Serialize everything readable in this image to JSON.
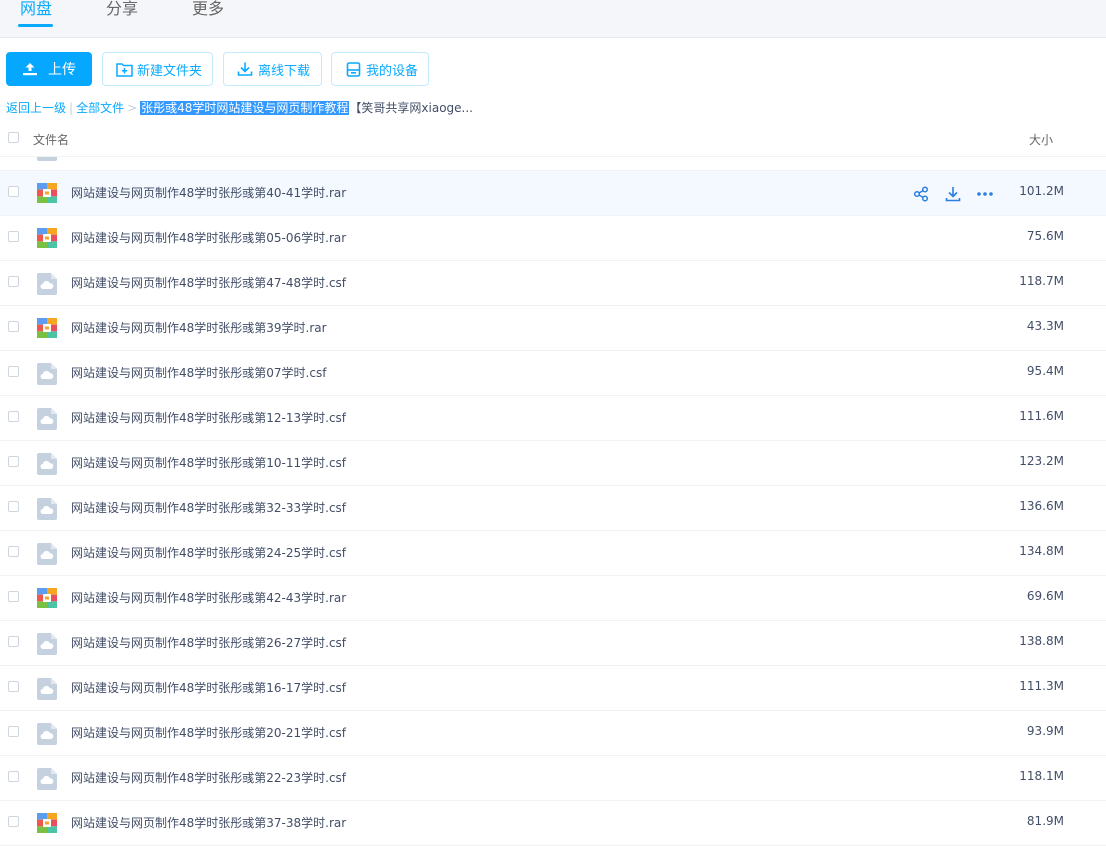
{
  "nav": {
    "tabs": [
      {
        "label": "网盘",
        "active": true
      },
      {
        "label": "分享",
        "active": false
      },
      {
        "label": "更多",
        "active": false
      }
    ]
  },
  "toolbar": {
    "upload": "上传",
    "new_folder": "新建文件夹",
    "offline_download": "离线下载",
    "my_devices": "我的设备"
  },
  "breadcrumb": {
    "back": "返回上一级",
    "root": "全部文件",
    "current": "张彤彧48学时网站建设与网页制作教程",
    "rest": "【笑哥共享网xiaoge..."
  },
  "table": {
    "col_name": "文件名",
    "col_size": "大小"
  },
  "files": [
    {
      "name": "网站建设与网页制作48学时张彤彧第40-41学时.rar",
      "size": "101.2M",
      "type": "rar",
      "hovered": true
    },
    {
      "name": "网站建设与网页制作48学时张彤彧第05-06学时.rar",
      "size": "75.6M",
      "type": "rar"
    },
    {
      "name": "网站建设与网页制作48学时张彤彧第47-48学时.csf",
      "size": "118.7M",
      "type": "csf"
    },
    {
      "name": "网站建设与网页制作48学时张彤彧第39学时.rar",
      "size": "43.3M",
      "type": "rar"
    },
    {
      "name": "网站建设与网页制作48学时张彤彧第07学时.csf",
      "size": "95.4M",
      "type": "csf"
    },
    {
      "name": "网站建设与网页制作48学时张彤彧第12-13学时.csf",
      "size": "111.6M",
      "type": "csf"
    },
    {
      "name": "网站建设与网页制作48学时张彤彧第10-11学时.csf",
      "size": "123.2M",
      "type": "csf"
    },
    {
      "name": "网站建设与网页制作48学时张彤彧第32-33学时.csf",
      "size": "136.6M",
      "type": "csf"
    },
    {
      "name": "网站建设与网页制作48学时张彤彧第24-25学时.csf",
      "size": "134.8M",
      "type": "csf"
    },
    {
      "name": "网站建设与网页制作48学时张彤彧第42-43学时.rar",
      "size": "69.6M",
      "type": "rar"
    },
    {
      "name": "网站建设与网页制作48学时张彤彧第26-27学时.csf",
      "size": "138.8M",
      "type": "csf"
    },
    {
      "name": "网站建设与网页制作48学时张彤彧第16-17学时.csf",
      "size": "111.3M",
      "type": "csf"
    },
    {
      "name": "网站建设与网页制作48学时张彤彧第20-21学时.csf",
      "size": "93.9M",
      "type": "csf"
    },
    {
      "name": "网站建设与网页制作48学时张彤彧第22-23学时.csf",
      "size": "118.1M",
      "type": "csf"
    },
    {
      "name": "网站建设与网页制作48学时张彤彧第37-38学时.rar",
      "size": "81.9M",
      "type": "rar"
    }
  ],
  "colors": {
    "accent": "#06a7ff",
    "text": "#424e67"
  },
  "icons": [
    "upload-icon",
    "new-folder-icon",
    "download-icon",
    "device-icon",
    "share-icon",
    "more-icon",
    "rar-file-icon",
    "cloud-file-icon"
  ]
}
